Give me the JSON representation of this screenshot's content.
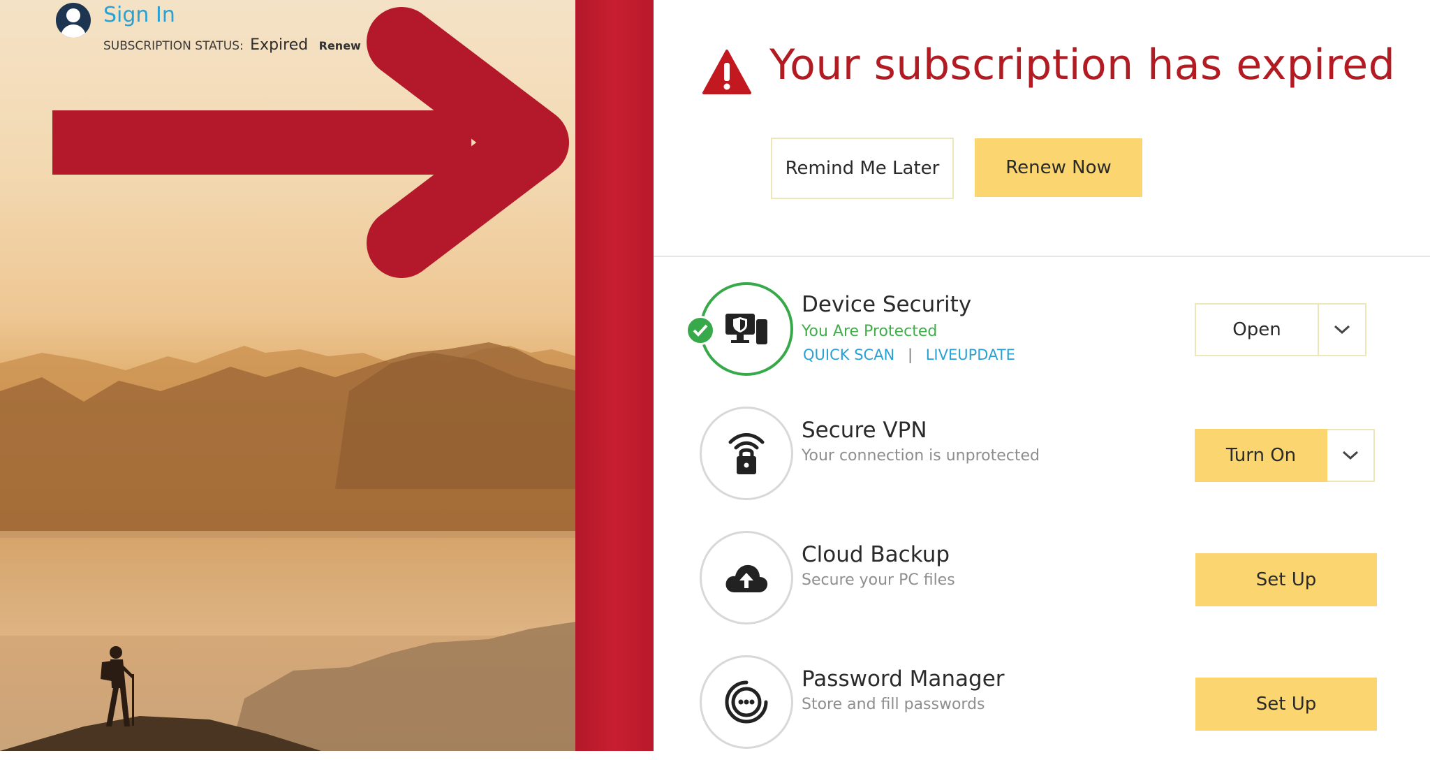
{
  "account": {
    "sign_in": "Sign In",
    "status_label": "SUBSCRIPTION STATUS:",
    "status_value": "Expired",
    "renew_link": "Renew"
  },
  "alert": {
    "title": "Your subscription has expired",
    "remind_button": "Remind Me Later",
    "renew_button": "Renew Now"
  },
  "features": [
    {
      "title": "Device Security",
      "status": "You Are Protected",
      "links": [
        "QUICK SCAN",
        "LIVEUPDATE"
      ],
      "separator": "|",
      "action": "Open",
      "icon": "device-shield-icon"
    },
    {
      "title": "Secure VPN",
      "status": "Your connection is unprotected",
      "action": "Turn On",
      "icon": "wifi-lock-icon"
    },
    {
      "title": "Cloud Backup",
      "status": "Secure your PC files",
      "action": "Set Up",
      "icon": "cloud-upload-icon"
    },
    {
      "title": "Password Manager",
      "status": "Store and fill passwords",
      "action": "Set Up",
      "icon": "password-vault-icon"
    }
  ],
  "colors": {
    "accent_red": "#c71f31",
    "alert_red": "#b31b23",
    "button_yellow": "#fbd56f",
    "link_blue": "#2aa1d3",
    "protected_green": "#37a94a"
  }
}
